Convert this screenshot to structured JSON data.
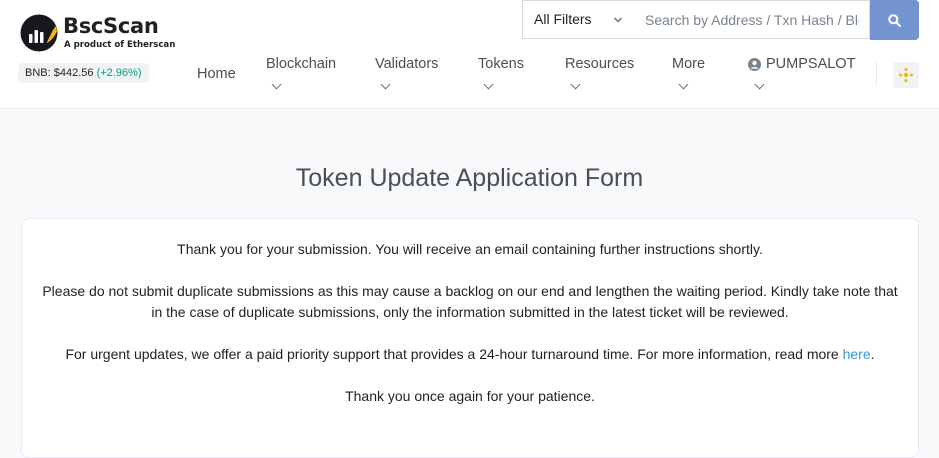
{
  "brand": {
    "name": "BscScan",
    "tagline": "A product of Etherscan"
  },
  "price_ticker": {
    "label": "BNB: $442.56",
    "change": "(+2.96%)"
  },
  "search": {
    "filter_label": "All Filters",
    "placeholder": "Search by Address / Txn Hash / Block / Token"
  },
  "nav": {
    "home": "Home",
    "blockchain": "Blockchain",
    "validators": "Validators",
    "tokens": "Tokens",
    "resources": "Resources",
    "more": "More",
    "account": "PUMPSALOT"
  },
  "page": {
    "title": "Token Update Application Form",
    "line1": "Thank you for your submission. You will receive an email containing further instructions shortly.",
    "line2a": "Please do not submit duplicate submissions as this may cause a backlog on our end and lengthen the waiting period. Kindly take note that",
    "line2b": "in the case of duplicate submissions, only the information submitted in the latest ticket will be reviewed.",
    "line3_text": "For urgent updates, we offer a paid priority support that provides a 24-hour turnaround time. For more information, read more ",
    "line3_link": "here",
    "line3_end": ".",
    "line4": "Thank you once again for your patience."
  },
  "colors": {
    "accent": "#7393d1",
    "positive": "#00a186",
    "link": "#3498db",
    "brand_yellow": "#f0b90b"
  },
  "icons": [
    "bscscan-logo-icon",
    "chevron-down-icon",
    "search-icon",
    "user-circle-icon",
    "bnb-icon"
  ]
}
